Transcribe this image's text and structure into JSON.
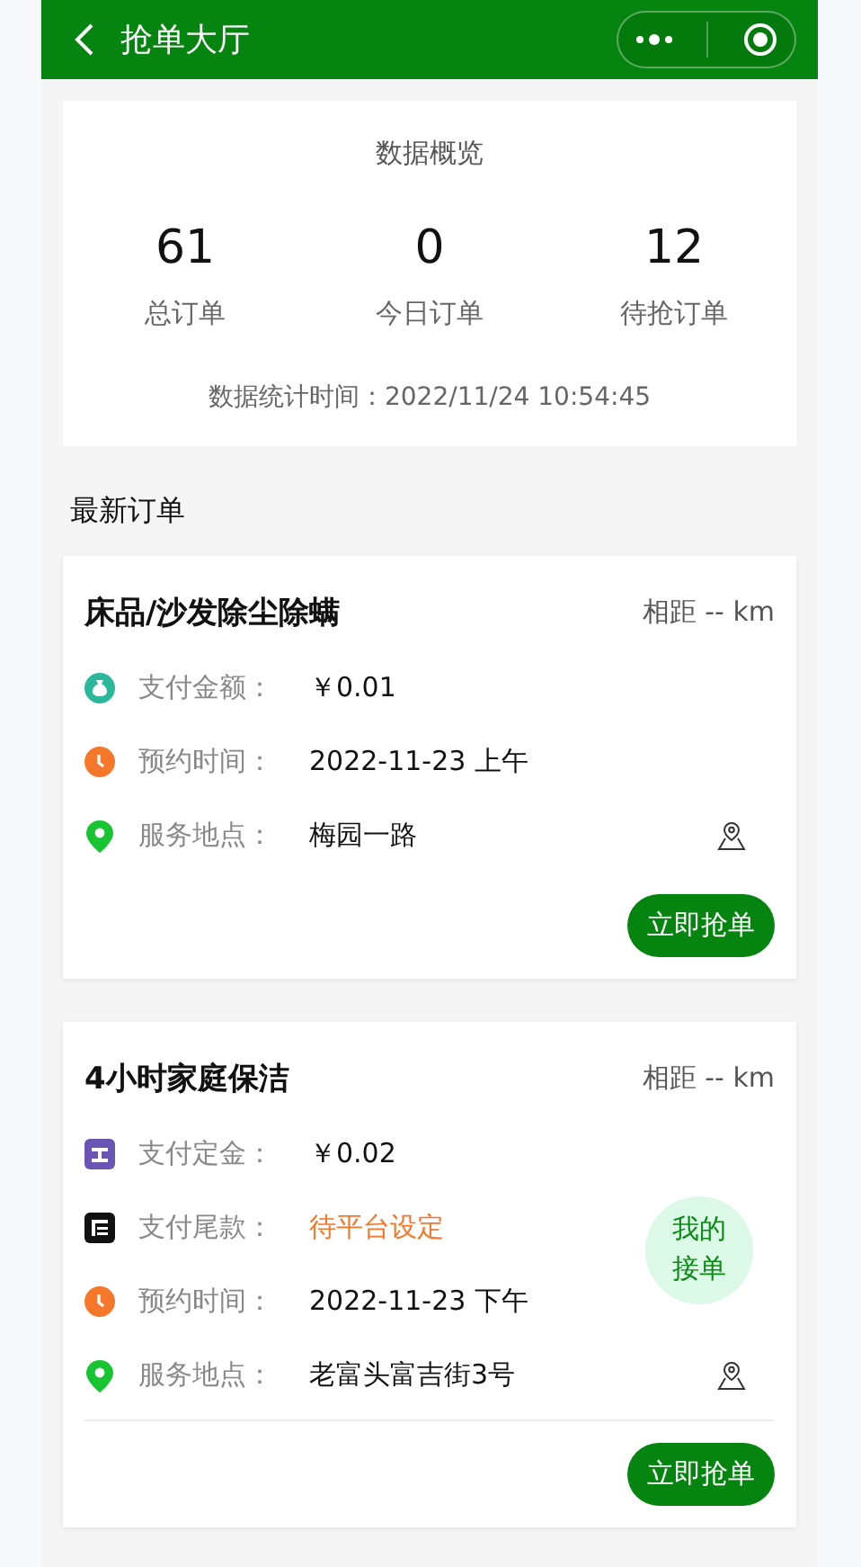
{
  "header": {
    "title": "抢单大厅"
  },
  "summary": {
    "title": "数据概览",
    "stats": [
      {
        "value": "61",
        "label": "总订单"
      },
      {
        "value": "0",
        "label": "今日订单"
      },
      {
        "value": "12",
        "label": "待抢订单"
      }
    ],
    "updated": "数据统计时间：2022/11/24 10:54:45"
  },
  "section_title": "最新订单",
  "orders": [
    {
      "title": "床品/沙发除尘除螨",
      "distance": "相距 -- km",
      "divider": false,
      "rows": [
        {
          "kind": "money",
          "label": "支付金额：",
          "value": "￥0.01",
          "pending": false
        },
        {
          "kind": "time",
          "label": "预约时间：",
          "value": "2022-11-23 上午",
          "pending": false
        },
        {
          "kind": "location",
          "label": "服务地点：",
          "value": "梅园一路",
          "pending": false
        }
      ],
      "button": "立即抢单"
    },
    {
      "title": "4小时家庭保洁",
      "distance": "相距 -- km",
      "divider": true,
      "badge": "我的接单",
      "rows": [
        {
          "kind": "deposit",
          "label": "支付定金：",
          "value": "￥0.02",
          "pending": false
        },
        {
          "kind": "balance",
          "label": "支付尾款：",
          "value": "待平台设定",
          "pending": true
        },
        {
          "kind": "time",
          "label": "预约时间：",
          "value": "2022-11-23 下午",
          "pending": false
        },
        {
          "kind": "location",
          "label": "服务地点：",
          "value": "老富头富吉街3号",
          "pending": false
        }
      ],
      "button": "立即抢单"
    }
  ]
}
